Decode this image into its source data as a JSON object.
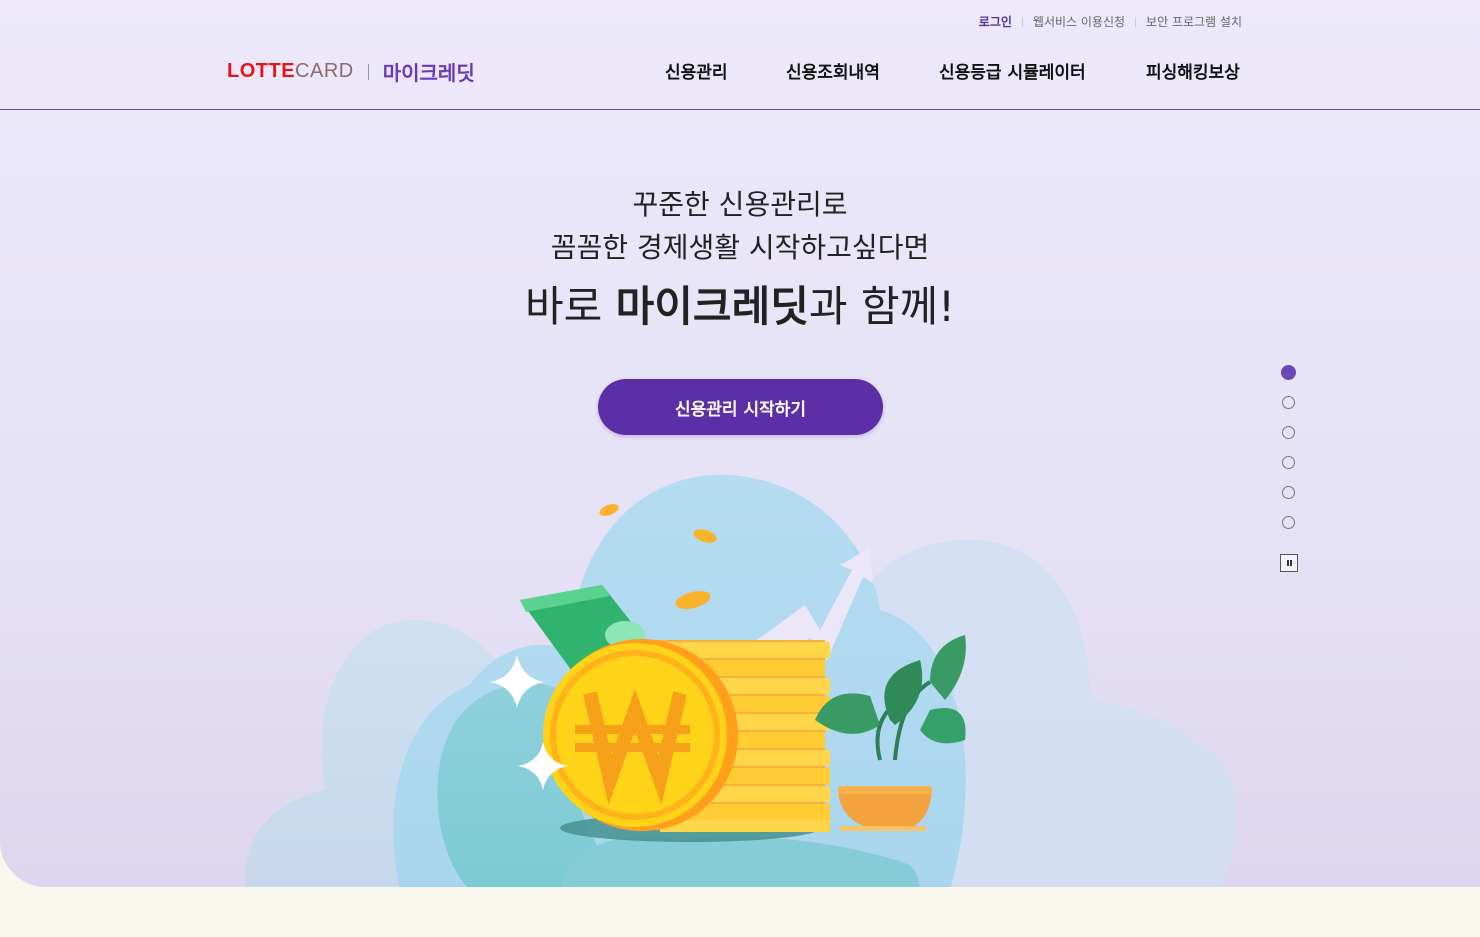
{
  "header": {
    "util_links": [
      "로그인",
      "웹서비스 이용신청",
      "보안 프로그램 설치"
    ],
    "logo": {
      "brand_lotte": "LOTTE",
      "brand_card": "CARD",
      "service": "마이크레딧"
    },
    "nav": [
      "신용관리",
      "신용조회내역",
      "신용등급 시뮬레이터",
      "피싱해킹보상"
    ]
  },
  "hero": {
    "line1": "꾸준한 신용관리로",
    "line2": "꼼꼼한 경제생활 시작하고싶다면",
    "line3_prefix": "바로 ",
    "line3_bold": "마이크레딧",
    "line3_suffix": "과 함께!",
    "cta_label": "신용관리 시작하기"
  },
  "slider": {
    "slide_count": 6,
    "active_index": 0,
    "paused": false
  },
  "colors": {
    "accent": "#5d2ea6",
    "brand_red": "#e3161b",
    "bg": "#ede9fb"
  },
  "icons": {
    "pause": "pause-icon",
    "coin": "won-coin-icon",
    "arrow": "trend-arrow-icon"
  }
}
